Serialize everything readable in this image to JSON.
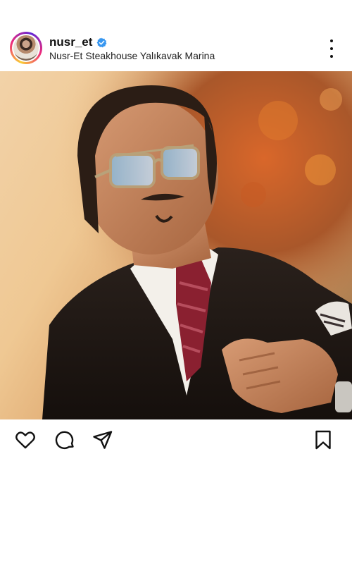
{
  "post": {
    "username": "nusr_et",
    "verified": true,
    "location": "Nusr-Et Steakhouse Yalıkavak Marina"
  },
  "icons": {
    "more": "more-options-icon",
    "like": "heart-icon",
    "comment": "comment-icon",
    "share": "send-icon",
    "save": "bookmark-icon",
    "verified": "verified-badge-icon"
  },
  "colors": {
    "verified_blue": "#3897f0",
    "text": "#111111"
  }
}
